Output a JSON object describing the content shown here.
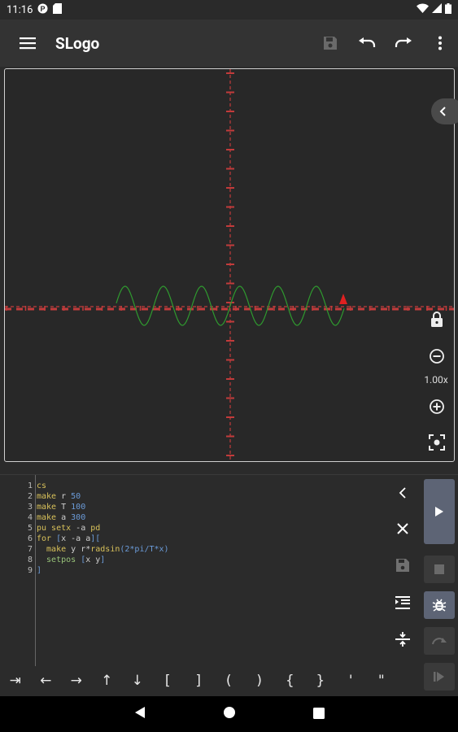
{
  "status": {
    "time": "11:16"
  },
  "app": {
    "title": "SLogo"
  },
  "canvas": {
    "zoom": "1.00x"
  },
  "editor": {
    "line_numbers": [
      "1",
      "2",
      "3",
      "4",
      "5",
      "6",
      "7",
      "8",
      "9"
    ],
    "lines": [
      [
        {
          "t": "cs",
          "c": "kw"
        }
      ],
      [
        {
          "t": "make ",
          "c": "kw"
        },
        {
          "t": "r ",
          "c": "txt"
        },
        {
          "t": "50",
          "c": "num"
        }
      ],
      [
        {
          "t": "make ",
          "c": "kw"
        },
        {
          "t": "T ",
          "c": "txt"
        },
        {
          "t": "100",
          "c": "num"
        }
      ],
      [
        {
          "t": "make ",
          "c": "kw"
        },
        {
          "t": "a ",
          "c": "txt"
        },
        {
          "t": "300",
          "c": "num"
        }
      ],
      [
        {
          "t": "pu setx ",
          "c": "kw"
        },
        {
          "t": "-a ",
          "c": "txt"
        },
        {
          "t": "pd",
          "c": "kw"
        }
      ],
      [
        {
          "t": "for ",
          "c": "kw"
        },
        {
          "t": "[",
          "c": "br"
        },
        {
          "t": "x -a a",
          "c": "txt"
        },
        {
          "t": "][",
          "c": "br"
        }
      ],
      [
        {
          "t": "  make ",
          "c": "kw"
        },
        {
          "t": "y r*",
          "c": "txt"
        },
        {
          "t": "radsin",
          "c": "kw"
        },
        {
          "t": "(2*pi/T*x)",
          "c": "num"
        }
      ],
      [
        {
          "t": "  setpos ",
          "c": "fn"
        },
        {
          "t": "[",
          "c": "br"
        },
        {
          "t": "x y",
          "c": "txt"
        },
        {
          "t": "]",
          "c": "br"
        }
      ],
      [
        {
          "t": "]",
          "c": "br"
        }
      ]
    ]
  },
  "keys": [
    "⇥",
    "←",
    "→",
    "↑",
    "↓",
    "[",
    "]",
    "(",
    ")",
    "{",
    "}",
    "'",
    "\""
  ],
  "colors": {
    "axis": "#c23b3b",
    "curve": "#2f9a2f",
    "turtle": "#e02020",
    "run_button": "#5d6475"
  }
}
